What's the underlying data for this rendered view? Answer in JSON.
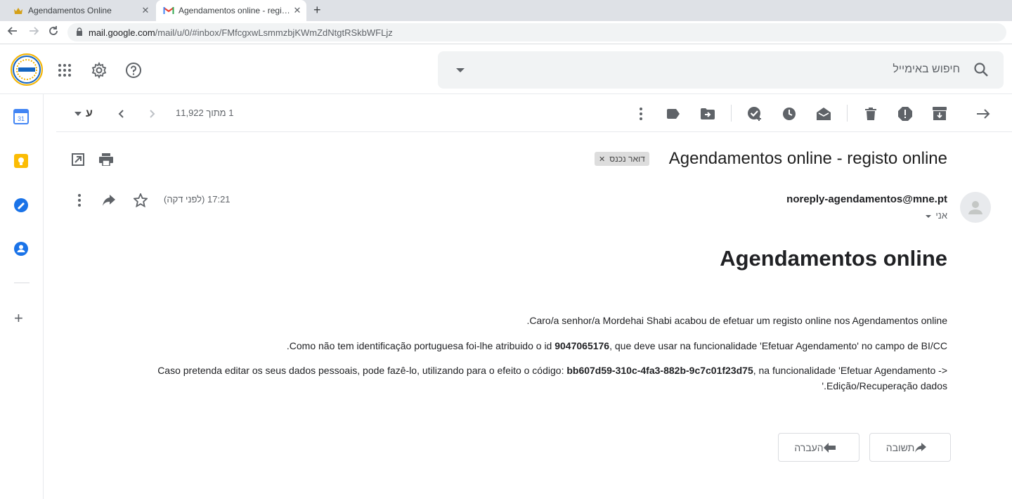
{
  "browser": {
    "tabs": [
      {
        "title": "Agendamentos Online"
      },
      {
        "title": "Agendamentos online - registo online"
      }
    ],
    "url_host": "mail.google.com",
    "url_path": "/mail/u/0/#inbox/FMfcgxwLsmmzbjKWmZdNtgtRSkbWFLjz"
  },
  "header": {
    "logo_text": "Goog MNE",
    "search_placeholder": "חיפוש באימייל"
  },
  "toolbar": {
    "pager": "1 מתוך 11,922",
    "input_tool": "ע"
  },
  "email": {
    "subject": "Agendamentos online - registo online",
    "label": "דואר נכנס",
    "sender": "noreply-agendamentos@mne.pt",
    "to": "אני",
    "time": "17:21 (לפני דקה)",
    "heading": "Agendamentos online",
    "p1": ".Caro/a senhor/a Mordehai Shabi acabou de efetuar um registo online nos Agendamentos online",
    "p2_pre": ".Como não tem identificação portuguesa foi-lhe atribuido o id ",
    "p2_id": "9047065176",
    "p2_post": ", que deve usar na funcionalidade 'Efetuar Agendamento' no campo de BI/CC",
    "p3_pre": "Caso pretenda editar os seus dados pessoais, pode fazê-lo, utilizando para o efeito o código: ",
    "p3_code": "bb607d59-310c-4fa3-882b-9c7c01f23d75",
    "p3_post": ", na funcionalidade 'Efetuar Agendamento ->",
    "p3_line2": "'.Edição/Recuperação dados"
  },
  "actions": {
    "reply": "תשובה",
    "forward": "העברה"
  },
  "colors": {
    "calendar": "#4285f4",
    "keep": "#fbbc04",
    "tasks": "#1a73e8",
    "contacts": "#1a73e8"
  }
}
